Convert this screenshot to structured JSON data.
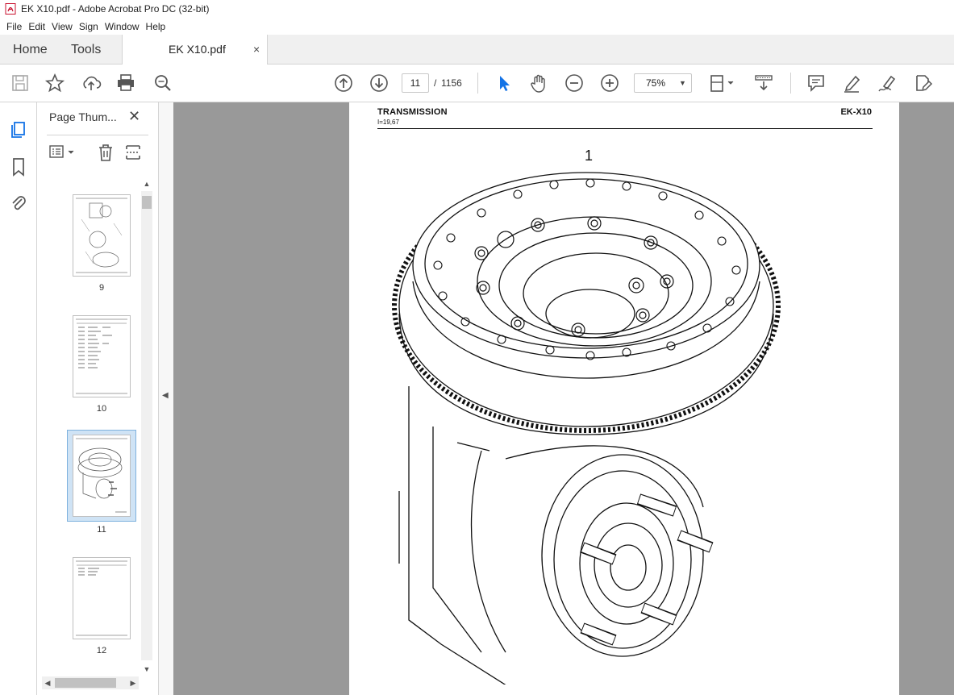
{
  "window": {
    "title": "EK X10.pdf - Adobe Acrobat Pro DC (32-bit)"
  },
  "menu": [
    "File",
    "Edit",
    "View",
    "Sign",
    "Window",
    "Help"
  ],
  "tabs": {
    "home": "Home",
    "tools": "Tools",
    "document": "EK X10.pdf",
    "close": "×"
  },
  "toolbar": {
    "current_page": "11",
    "page_separator": "/",
    "total_pages": "1156",
    "zoom": "75%"
  },
  "thumbnails_pane": {
    "title": "Page Thum...",
    "close": "✕",
    "pages": [
      {
        "number": "9"
      },
      {
        "number": "10"
      },
      {
        "number": "11",
        "selected": true
      },
      {
        "number": "12"
      }
    ]
  },
  "document": {
    "header_title": "TRANSMISSION",
    "header_subtitle": "I=19,67",
    "header_model": "EK-X10",
    "figure_label": "1"
  },
  "icons": {
    "save": "save-icon",
    "bookmark": "star-icon",
    "upload": "upload-icon",
    "print": "print-icon",
    "find": "zoom-search-icon",
    "prev": "arrow-up-circle-icon",
    "next": "arrow-down-circle-icon",
    "select": "cursor-arrow-icon",
    "hand": "hand-icon",
    "zoom_out": "zoom-out-icon",
    "zoom_in": "zoom-in-icon",
    "fit": "fit-page-icon",
    "scroll_mode": "scroll-mode-icon",
    "comment": "comment-icon",
    "highlight": "highlight-pen-icon",
    "sign": "sign-pen-icon",
    "share": "share-edit-icon"
  },
  "colors": {
    "accent": "#1473e6",
    "canvas": "#999999",
    "selection": "#cfe3f5"
  }
}
